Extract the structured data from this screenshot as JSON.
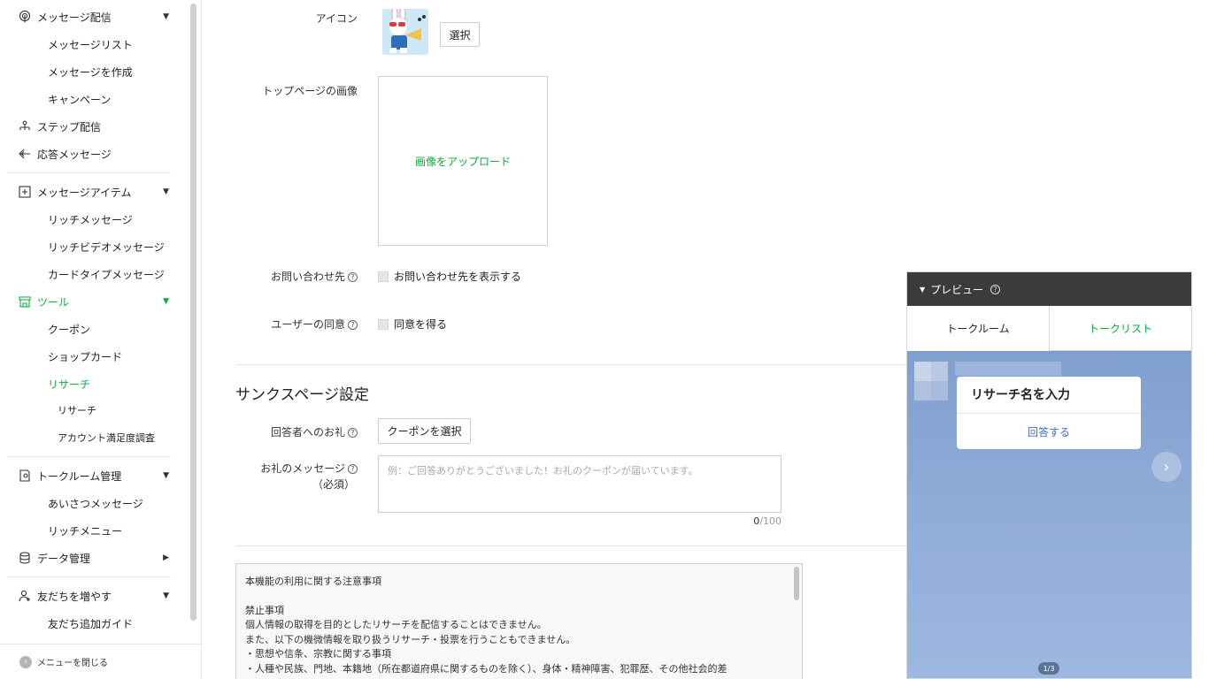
{
  "sidebar": {
    "items": [
      {
        "label": "メッセージ配信",
        "icon": "broadcast-icon",
        "caret": "▼"
      },
      {
        "label": "メッセージリスト"
      },
      {
        "label": "メッセージを作成"
      },
      {
        "label": "キャンペーン"
      },
      {
        "label": "ステップ配信",
        "icon": "step-icon"
      },
      {
        "label": "応答メッセージ",
        "icon": "reply-icon"
      },
      {
        "label": "メッセージアイテム",
        "icon": "message-item-icon",
        "caret": "▼"
      },
      {
        "label": "リッチメッセージ"
      },
      {
        "label": "リッチビデオメッセージ"
      },
      {
        "label": "カードタイプメッセージ"
      },
      {
        "label": "ツール",
        "icon": "store-icon",
        "caret": "▼"
      },
      {
        "label": "クーポン"
      },
      {
        "label": "ショップカード"
      },
      {
        "label": "リサーチ"
      },
      {
        "label": "リサーチ"
      },
      {
        "label": "アカウント満足度調査"
      },
      {
        "label": "トークルーム管理",
        "icon": "talkroom-icon",
        "caret": "▼"
      },
      {
        "label": "あいさつメッセージ"
      },
      {
        "label": "リッチメニュー"
      },
      {
        "label": "データ管理",
        "icon": "database-icon",
        "caret": "▶"
      },
      {
        "label": "友だちを増やす",
        "icon": "add-friend-icon",
        "caret": "▼"
      },
      {
        "label": "友だち追加ガイド"
      }
    ],
    "footer_label": "メニューを閉じる"
  },
  "form": {
    "icon_label": "アイコン",
    "icon_select": "選択",
    "top_image_label": "トップページの画像",
    "upload_label": "画像をアップロード",
    "contact_label": "お問い合わせ先",
    "contact_checkbox": "お問い合わせ先を表示する",
    "consent_label": "ユーザーの同意",
    "consent_checkbox": "同意を得る",
    "thanks_section_title": "サンクスページ設定",
    "reward_label": "回答者へのお礼",
    "coupon_button": "クーポンを選択",
    "thanks_msg_label": "お礼のメッセージ",
    "required_label": "（必須）",
    "thanks_msg_placeholder": "例：ご回答ありがとうございました！お礼のクーポンが届いています。",
    "char_count_current": "0",
    "char_count_max": "/100"
  },
  "notice": {
    "title": "本機能の利用に関する注意事項",
    "heading": "禁止事項",
    "lines": [
      "個人情報の取得を目的としたリサーチを配信することはできません。",
      "また、以下の機微情報を取り扱うリサーチ・投票を行うこともできません。",
      "・思想や信条、宗教に関する事項",
      "・人種や民族、門地、本籍地（所在都道府県に関するものを除く）、身体・精神障害、犯罪歴、その他社会的差"
    ]
  },
  "preview": {
    "title": "プレビュー",
    "tab_talkroom": "トークルーム",
    "tab_talklist": "トークリスト",
    "card_title": "リサーチ名を入力",
    "card_button": "回答する",
    "pager": "1/3"
  },
  "colors": {
    "accent_green": "#06b13a",
    "preview_header": "#3b3b3b",
    "chat_background": "#8aa7d6"
  }
}
